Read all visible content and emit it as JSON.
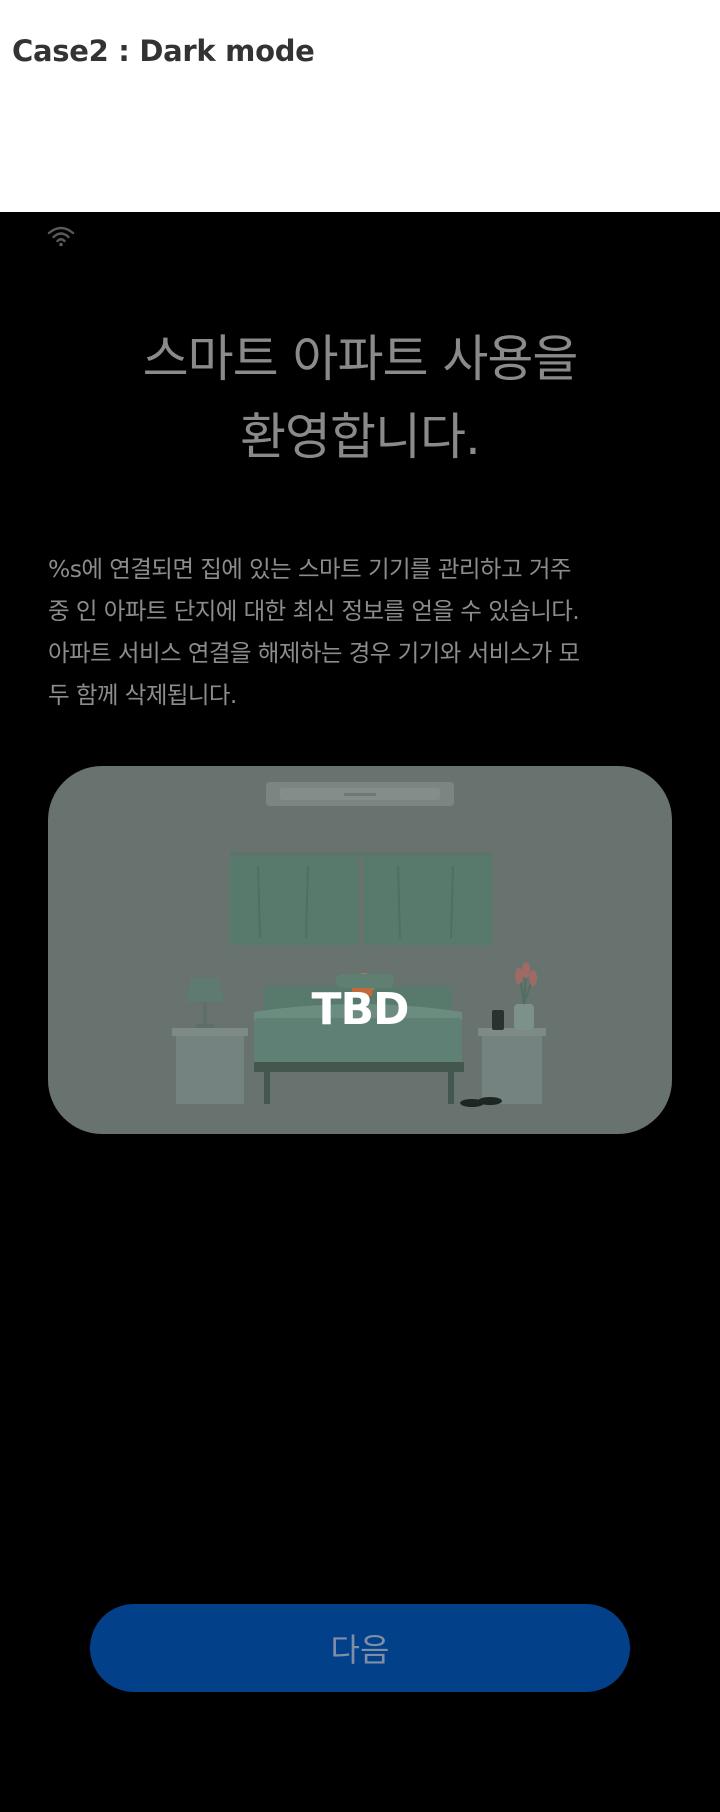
{
  "case_header": {
    "title": "Case2 : Dark mode"
  },
  "screen": {
    "status_bar": {
      "icon": "wifi-icon"
    },
    "headline": {
      "line1": "스마트 아파트 사용을",
      "line2": "환영합니다."
    },
    "description": " %s에 연결되면 집에 있는 스마트 기기를 관리하고 거주\n중 인 아파트 단지에 대한 최신 정보를 얻을 수 있습니다.\n아파트 서비스 연결을 해제하는 경우 기기와 서비스가 모\n두 함께 삭제됩니다.",
    "illustration": {
      "label": "TBD",
      "icon": "bedroom-illustration"
    },
    "next_button": {
      "label": "다음"
    }
  },
  "colors": {
    "screen_bg": "#000000",
    "card_bg": "#687370",
    "button_bg": "#02418a",
    "button_text": "#7f8ea5",
    "text_muted": "#8a8a8a"
  }
}
